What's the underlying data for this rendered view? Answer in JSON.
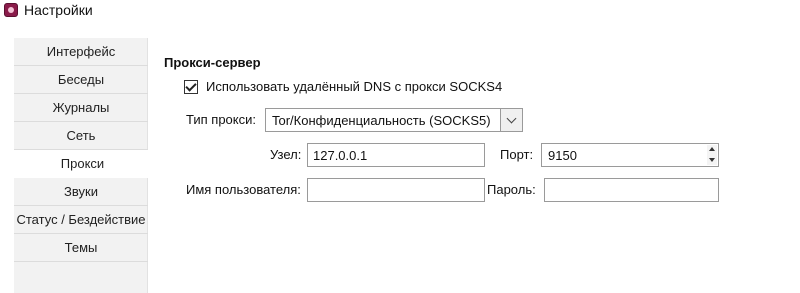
{
  "window": {
    "title": "Настройки",
    "icon": "app-icon"
  },
  "nav": {
    "items": [
      {
        "label": "Интерфейс"
      },
      {
        "label": "Беседы"
      },
      {
        "label": "Журналы"
      },
      {
        "label": "Сеть"
      },
      {
        "label": "Прокси"
      },
      {
        "label": "Звуки"
      },
      {
        "label": "Статус / Бездействие"
      },
      {
        "label": "Темы"
      }
    ],
    "selected": "Прокси"
  },
  "proxy": {
    "section_title": "Прокси-сервер",
    "remote_dns": {
      "label": "Использовать удалённый DNS с прокси SOCKS4",
      "checked": true
    },
    "proxy_type": {
      "label": "Тип прокси:",
      "value": "Tor/Конфиденциальность (SOCKS5)"
    },
    "host": {
      "label": "Узел:",
      "value": "127.0.0.1"
    },
    "port": {
      "label": "Порт:",
      "value": "9150"
    },
    "username": {
      "label": "Имя пользователя:",
      "value": ""
    },
    "password": {
      "label": "Пароль:",
      "value": ""
    }
  }
}
